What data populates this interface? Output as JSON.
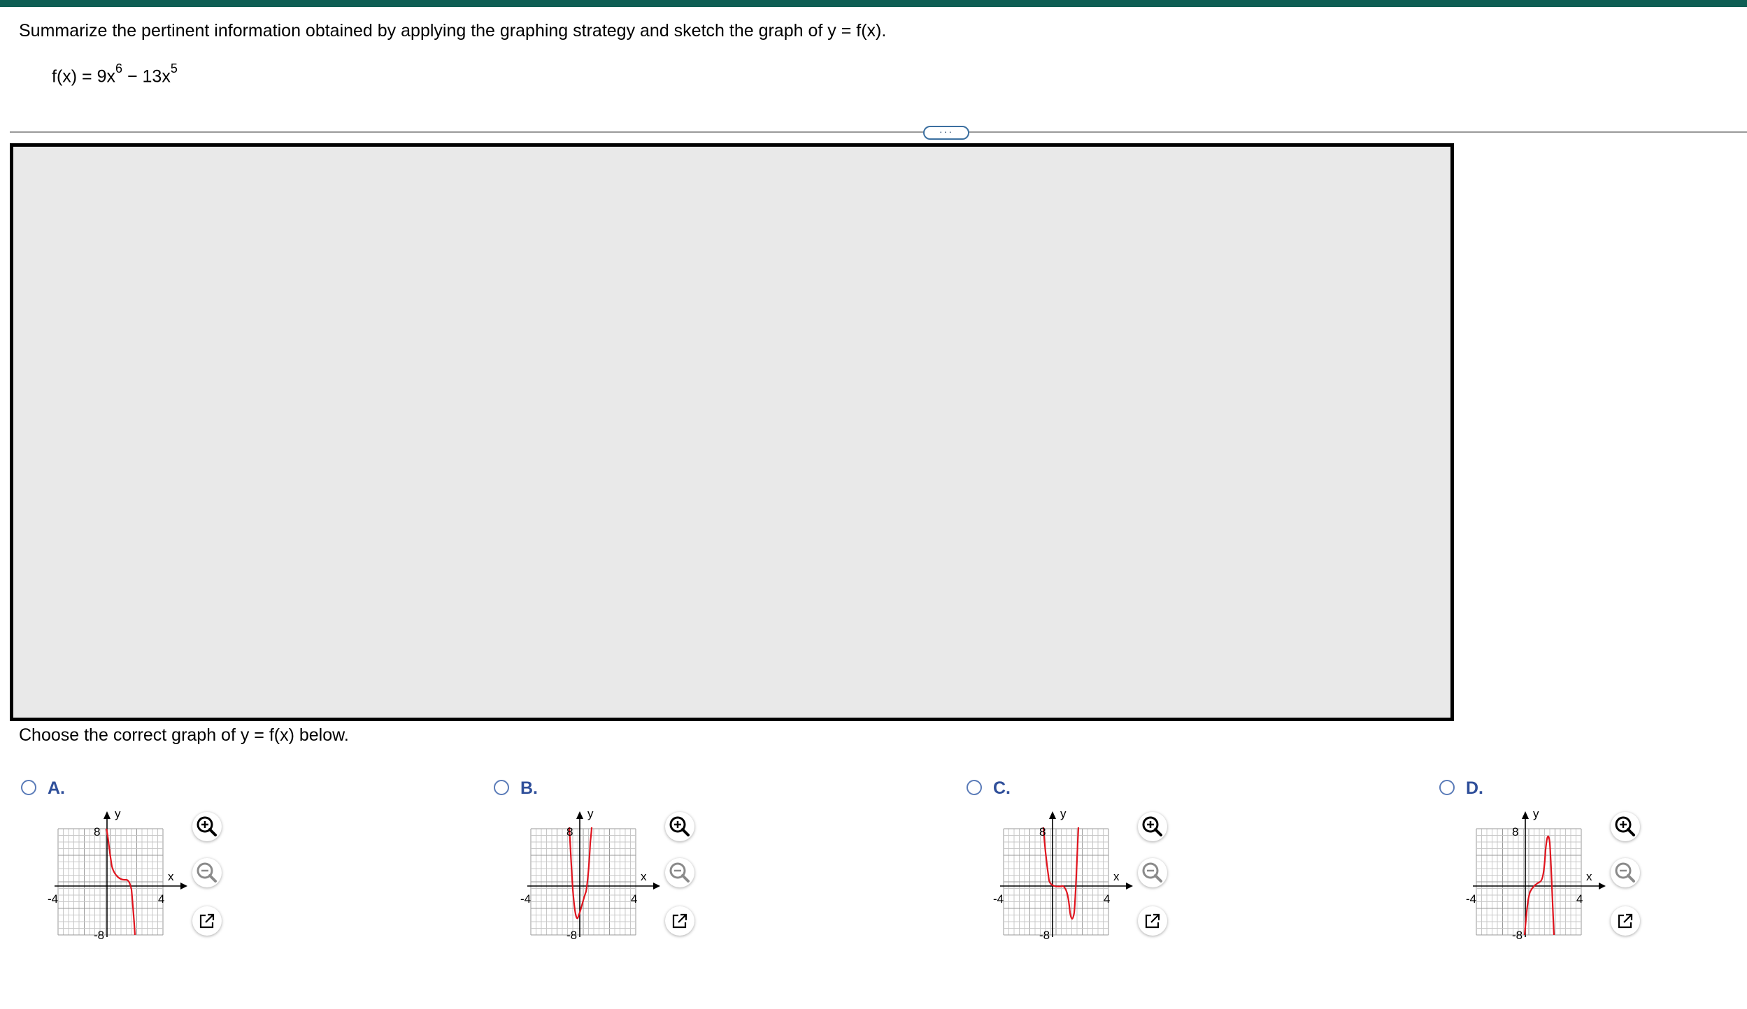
{
  "header": {
    "color": "#0f5e54"
  },
  "question": {
    "prompt": "Summarize the pertinent information obtained by applying the graphing strategy and sketch the graph of y = f(x).",
    "formula": {
      "prefix": "f(x) = 9x",
      "exp1": "6",
      "middle": " − 13x",
      "exp2": "5"
    }
  },
  "more_button": {
    "label": "···"
  },
  "choose_prompt": "Choose the correct graph of y = f(x) below.",
  "options": [
    {
      "letter": "A.",
      "selected": false
    },
    {
      "letter": "B.",
      "selected": false
    },
    {
      "letter": "C.",
      "selected": false
    },
    {
      "letter": "D.",
      "selected": false
    }
  ],
  "graph_labels": {
    "y": "y",
    "x": "x",
    "ymax": "8",
    "ymin": "-8",
    "xmin": "-4",
    "xmax": "4"
  },
  "tool_icons": [
    "zoom-in-icon",
    "zoom-out-icon",
    "popout-icon"
  ]
}
